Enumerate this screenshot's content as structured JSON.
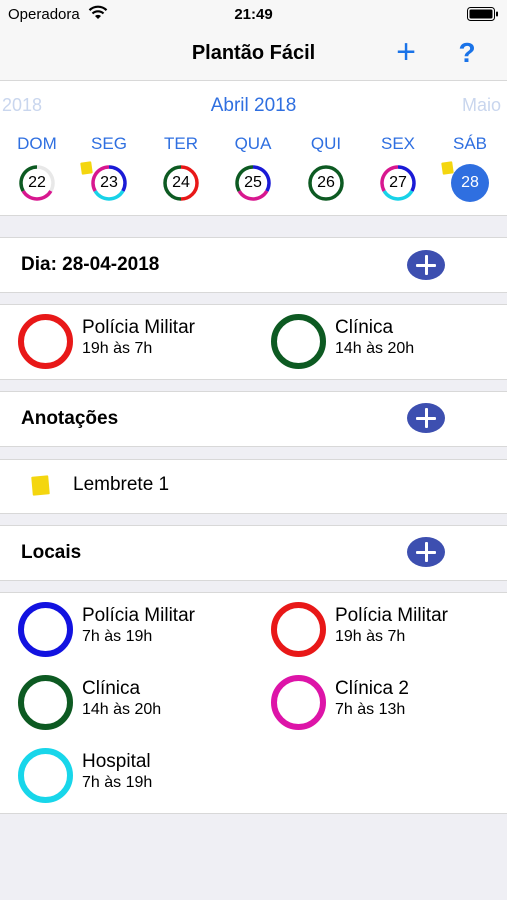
{
  "status_bar": {
    "carrier": "Operadora",
    "time": "21:49",
    "icons": [
      "wifi-icon",
      "battery-icon"
    ]
  },
  "nav": {
    "title": "Plantão Fácil",
    "add_label": "+",
    "help_label": "?"
  },
  "calendar": {
    "prev_month": "2018",
    "month": "Abril 2018",
    "next_month": "Maio",
    "weekdays": [
      "DOM",
      "SEG",
      "TER",
      "QUA",
      "QUI",
      "SEX",
      "SÁB"
    ],
    "days": [
      {
        "num": "22",
        "rings": [
          "#e8e8e8",
          "#d8178f",
          "#0d5a22"
        ],
        "note": false,
        "selected": false
      },
      {
        "num": "23",
        "rings": [
          "#1a1ad6",
          "#18d2e8",
          "#d8178f"
        ],
        "note": true,
        "selected": false
      },
      {
        "num": "24",
        "rings": [
          "#e81818",
          "#0d5a22"
        ],
        "note": false,
        "selected": false
      },
      {
        "num": "25",
        "rings": [
          "#1a1ad6",
          "#d8178f",
          "#0d5a22"
        ],
        "note": false,
        "selected": false
      },
      {
        "num": "26",
        "rings": [
          "#0d5a22"
        ],
        "note": false,
        "selected": false
      },
      {
        "num": "27",
        "rings": [
          "#1a1ad6",
          "#18d2e8",
          "#d8178f"
        ],
        "note": false,
        "selected": false
      },
      {
        "num": "28",
        "rings": [],
        "note": true,
        "selected": true
      }
    ],
    "selected_color": "#2f6fe0"
  },
  "day_section": {
    "title": "Dia: 28-04-2018"
  },
  "day_shifts": [
    {
      "name": "Polícia Militar",
      "hours": "19h às 7h",
      "color": "#e81818"
    },
    {
      "name": "Clínica",
      "hours": "14h às 20h",
      "color": "#0d5a22"
    }
  ],
  "notes_section": {
    "title": "Anotações"
  },
  "notes": [
    {
      "text": "Lembrete 1",
      "icon": "note-icon"
    }
  ],
  "places_section": {
    "title": "Locais"
  },
  "places": [
    {
      "name": "Polícia Militar",
      "hours": "7h às 19h",
      "color": "#1212e0"
    },
    {
      "name": "Polícia Militar",
      "hours": "19h às 7h",
      "color": "#e81818"
    },
    {
      "name": "Clínica",
      "hours": "14h às 20h",
      "color": "#0d5a22"
    },
    {
      "name": "Clínica 2",
      "hours": "7h às 13h",
      "color": "#dd14a8"
    },
    {
      "name": "Hospital",
      "hours": "7h às 19h",
      "color": "#18d6ea"
    }
  ]
}
